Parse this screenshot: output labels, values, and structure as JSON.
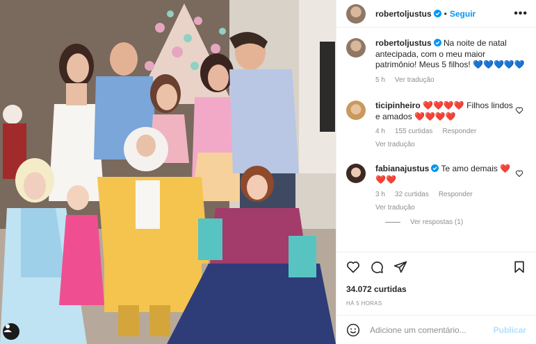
{
  "post": {
    "author": "robertoljustus",
    "follow_label": "Seguir",
    "more_label": "•••"
  },
  "caption": {
    "username": "robertoljustus",
    "text": "Na noite de natal antecipada, com o meu maior patrimônio! Meus 5 filhos!",
    "emojis": "💙💙💙💙💙",
    "time": "5 h",
    "translate": "Ver tradução"
  },
  "comments": [
    {
      "username": "ticipinheiro",
      "emojis_before": "❤️❤️❤️❤️",
      "text": "Filhos lindos e amados",
      "emojis_after": "❤️❤️❤️❤️",
      "time": "4 h",
      "likes": "155 curtidas",
      "reply": "Responder",
      "translate": "Ver tradução"
    },
    {
      "username": "fabianajustus",
      "text": "Te amo demais",
      "emojis_after": "❤️❤️❤️",
      "time": "3 h",
      "likes": "32 curtidas",
      "reply": "Responder",
      "translate": "Ver tradução",
      "view_replies": "Ver respostas (1)"
    }
  ],
  "stats": {
    "likes": "34.072 curtidas",
    "date": "HÁ 5 HORAS"
  },
  "composer": {
    "placeholder": "Adicione um comentário...",
    "publish": "Publicar"
  },
  "icons": {
    "like": "heart-icon",
    "comment": "comment-icon",
    "share": "share-icon",
    "save": "bookmark-icon",
    "emoji": "smile-icon",
    "tagged_user": "user-icon"
  },
  "colors": {
    "link_blue": "#0095f6",
    "verified_blue": "#0095f6",
    "publish_disabled": "#b2dffc",
    "heart_red": "#e0245e"
  }
}
